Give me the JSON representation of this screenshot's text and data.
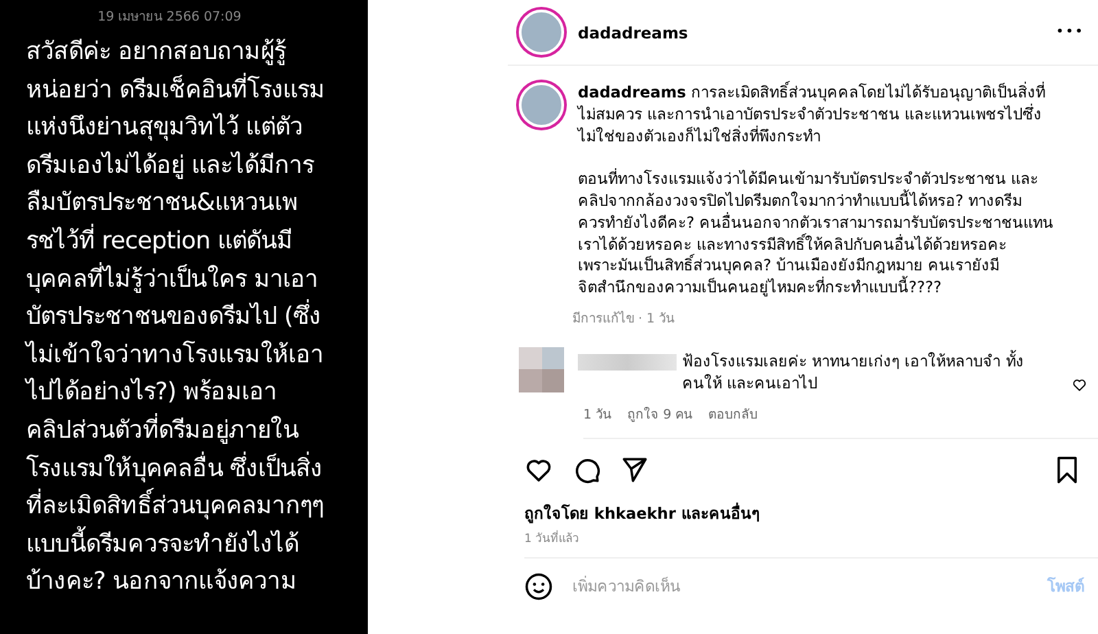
{
  "story": {
    "timestamp": "19 เมษายน 2566 07:09",
    "text": "สวัสดีค่ะ อยากสอบถามผู้รู้\nหน่อยว่า ดรีมเช็คอินที่โรงแรม\nแห่งนึงย่านสุขุมวิทไว้ แต่ตัว\nดรีมเองไม่ได้อยู่ และได้มีการ\nลืมบัตรประชาชน&แหวนเพ\nรชไว้ที่ reception แต่ดันมี\nบุคคลที่ไม่รู้ว่าเป็นใคร มาเอา\nบัตรประชาชนของดรีมไป (ซึ่ง\nไม่เข้าใจว่าทางโรงแรมให้เอา\nไปได้อย่างไร?) พร้อมเอา\nคลิปส่วนตัวที่ดรีมอยู่ภายใน\nโรงแรมให้บุคคลอื่น ซึ่งเป็นสิ่ง\nที่ละเมิดสิทธิ์ส่วนบุคคลมากๆๆ\nแบบนี้ดรีมควรจะทำยังไงได้\nบ้างคะ? นอกจากแจ้งความ"
  },
  "post": {
    "username": "dadadreams",
    "more": "•••",
    "caption": {
      "username": "dadadreams",
      "text": "การละเมิดสิทธิ์ส่วนบุคคลโดยไม่ได้รับอนุญาติเป็นสิ่งที่\nไม่สมควร และการนำเอาบัตรประจำตัวประชาชน และแหวนเพชรไปซึ่ง\nไม่ใช่ของตัวเองก็ไม่ใช่สิ่งที่พึงกระทำ\n\nตอนที่ทางโรงแรมแจ้งว่าได้มีคนเข้ามารับบัตรประจำตัวประชาชน และ\nคลิปจากกล้องวงจรปิดไปดรีมตกใจมากว่าทำแบบนี้ได้หรอ? ทางดรีม\nควรทำยังไงดีคะ? คนอื่นนอกจากตัวเราสามารถมารับบัตรประชาชนแทน\nเราได้ด้วยหรอคะ และทางรรมีสิทธิ์ให้คลิปกับคนอื่นได้ด้วยหรอคะ\nเพราะมันเป็นสิทธิ์ส่วนบุคคล? บ้านเมืองยังมีกฎหมาย คนเรายังมี\nจิตสำนึกของความเป็นคนอยู่ไหมคะที่กระทำแบบนี้????",
      "meta": "มีการแก้ไข · 1 วัน"
    },
    "comments": [
      {
        "text": "ฟ้องโรงแรมเลยค่ะ หาทนายเก่งๆ เอาให้หลาบจำ ทั้ง\nคนให้ และคนเอาไป",
        "time": "1 วัน",
        "likes": "ถูกใจ 9 คน",
        "reply": "ตอบกลับ"
      }
    ],
    "liked_by": "ถูกใจโดย khkaekhr และคนอื่นๆ",
    "posted": "1 วันที่แล้ว",
    "comment_field": {
      "placeholder": "เพิ่มความคิดเห็น"
    },
    "post_button": "โพสต์"
  }
}
